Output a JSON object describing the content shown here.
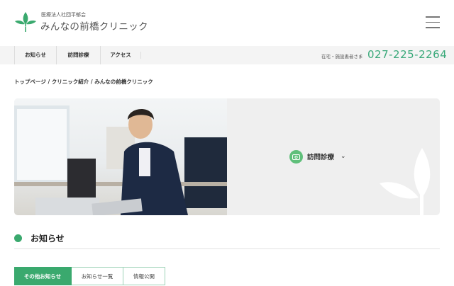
{
  "header": {
    "org": "医療法人社団平郁会",
    "name": "みんなの前橋クリニック"
  },
  "nav": {
    "items": [
      {
        "label": "お知らせ"
      },
      {
        "label": "訪問診療"
      },
      {
        "label": "アクセス"
      }
    ],
    "tel_label": "在宅・施設患者さま",
    "tel": "027-225-2264"
  },
  "breadcrumb": "トップページ / クリニック紹介 / みんなの前橋クリニック",
  "hero": {
    "link_label": "訪問診療"
  },
  "news": {
    "title": "お知らせ",
    "tabs": [
      {
        "label": "その他お知らせ"
      },
      {
        "label": "お知らせ一覧"
      },
      {
        "label": "情報公開"
      }
    ]
  },
  "colors": {
    "accent": "#3aa96e",
    "tel": "#3aa97a"
  }
}
